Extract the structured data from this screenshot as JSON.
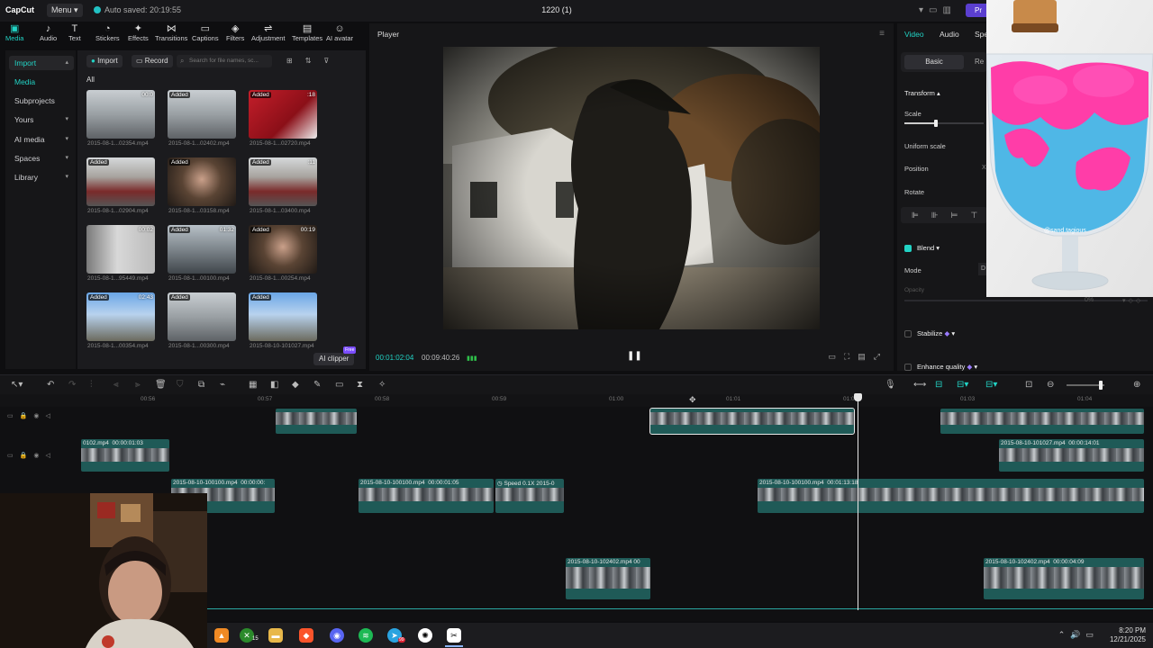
{
  "app": {
    "logo": "CapCut",
    "menu_label": "Menu",
    "autosave": "Auto saved: 20:19:55",
    "project_title": "1220 (1)",
    "pro_label": "Pr"
  },
  "toolbar": [
    {
      "label": "Media",
      "icon": "media-icon",
      "glyph": "▣",
      "active": true
    },
    {
      "label": "Audio",
      "icon": "audio-icon",
      "glyph": "♪"
    },
    {
      "label": "Text",
      "icon": "text-icon",
      "glyph": "T"
    },
    {
      "label": "Stickers",
      "icon": "stickers-icon",
      "glyph": "◔"
    },
    {
      "label": "Effects",
      "icon": "effects-icon",
      "glyph": "✦"
    },
    {
      "label": "Transitions",
      "icon": "transitions-icon",
      "glyph": "⋈"
    },
    {
      "label": "Captions",
      "icon": "captions-icon",
      "glyph": "▭"
    },
    {
      "label": "Filters",
      "icon": "filters-icon",
      "glyph": "◈"
    },
    {
      "label": "Adjustment",
      "icon": "adjustment-icon",
      "glyph": "⇌"
    },
    {
      "label": "Templates",
      "icon": "templates-icon",
      "glyph": "▤"
    },
    {
      "label": "AI avatar",
      "icon": "ai-avatar-icon",
      "glyph": "☺"
    }
  ],
  "leftnav": [
    {
      "label": "Import",
      "chevron": "▴",
      "selected": true
    },
    {
      "label": "Media",
      "active": true
    },
    {
      "label": "Subprojects"
    },
    {
      "label": "Yours",
      "chevron": "▾"
    },
    {
      "label": "AI media",
      "chevron": "▾"
    },
    {
      "label": "Spaces",
      "chevron": "▾"
    },
    {
      "label": "Library",
      "chevron": "▾"
    }
  ],
  "media": {
    "import_label": "Import",
    "record_label": "Record",
    "search_placeholder": "Search for file names, sc...",
    "all_label": "All",
    "ai_clipper_label": "AI clipper",
    "free_badge": "Free",
    "items": [
      {
        "name": "2015-08-1...02354.mp4",
        "badge": "",
        "duration": "00:0",
        "theme": "winter"
      },
      {
        "name": "2015-08-1...02402.mp4",
        "badge": "Added",
        "duration": "",
        "theme": "winter"
      },
      {
        "name": "2015-08-1...02720.mp4",
        "badge": "Added",
        "duration": ":18",
        "theme": "red"
      },
      {
        "name": "2015-08-1...02904.mp4",
        "badge": "Added",
        "duration": "",
        "theme": "people"
      },
      {
        "name": "2015-08-1...03158.mp4",
        "badge": "Added",
        "duration": "",
        "theme": "face"
      },
      {
        "name": "2015-08-1...03400.mp4",
        "badge": "Added",
        "duration": ":11",
        "theme": "people"
      },
      {
        "name": "2015-08-1...95449.mp4",
        "badge": "",
        "duration": "00:02",
        "theme": "blank"
      },
      {
        "name": "2015-08-1...00100.mp4",
        "badge": "Added",
        "duration": "01:32",
        "theme": "cars"
      },
      {
        "name": "2015-08-1...00254.mp4",
        "badge": "Added",
        "duration": "00:19",
        "theme": "face"
      },
      {
        "name": "2015-08-1...00354.mp4",
        "badge": "Added",
        "duration": "02:43",
        "theme": "sky"
      },
      {
        "name": "2015-08-1...00300.mp4",
        "badge": "Added",
        "duration": "",
        "theme": "winter"
      },
      {
        "name": "2015-08-10-101027.mp4",
        "badge": "Added",
        "duration": "",
        "theme": "sky"
      }
    ]
  },
  "player": {
    "title": "Player",
    "current_time": "00:01:02:04",
    "total_time": "00:09:40:26"
  },
  "properties": {
    "tabs": [
      "Video",
      "Audio",
      "Spe"
    ],
    "subtabs": [
      "Basic",
      "Re"
    ],
    "transform_label": "Transform",
    "scale_label": "Scale",
    "scale_value": 0.4,
    "uniform_scale_label": "Uniform scale",
    "position_label": "Position",
    "position_x": "X",
    "rotate_label": "Rotate",
    "blend_label": "Blend",
    "mode_label": "Mode",
    "mode_value": "D",
    "opacity_label": "Opacity",
    "opacity_value": "0%",
    "stabilize_label": "Stabilize",
    "enhance_label": "Enhance quality"
  },
  "overlay": {
    "sand_caption": "@sand.tagious"
  },
  "timeline": {
    "ruler": [
      "00:56",
      "00:57",
      "00:58",
      "00:59",
      "01:00",
      "01:01",
      "01:02",
      "01:03",
      "01:04"
    ],
    "clips": {
      "r2a_name": "0102.mp4",
      "r2a_dur": "00:00:01:03",
      "r2b_name": "2015-08-10-101027.mp4",
      "r2b_dur": "00:00:14:01",
      "r3a_name": "2015-08-10-100100.mp4",
      "r3a_dur": "00:00:00:",
      "r3b_name": "2015-08-10-100100.mp4",
      "r3b_dur": "00:00:01:05",
      "r3c_name": "Speed 0.1X",
      "r3c_extra": "2015-0",
      "r3d_name": "2015-08-10-100100.mp4",
      "r3d_dur": "00:01:13:18",
      "r4a_name": "2015-08-10-102402.mp4",
      "r4a_dur": "00",
      "r4b_name": "2015-08-10-102402.mp4",
      "r4b_dur": "00:00:04:09"
    }
  },
  "taskbar": {
    "badge_xbox": "15",
    "badge_mail": "99",
    "time": "8:20 PM",
    "date": "12/21/2025"
  },
  "colors": {
    "accent": "#22d3c5",
    "clip_teal": "#1f5a57",
    "bg": "#0e0e10"
  }
}
